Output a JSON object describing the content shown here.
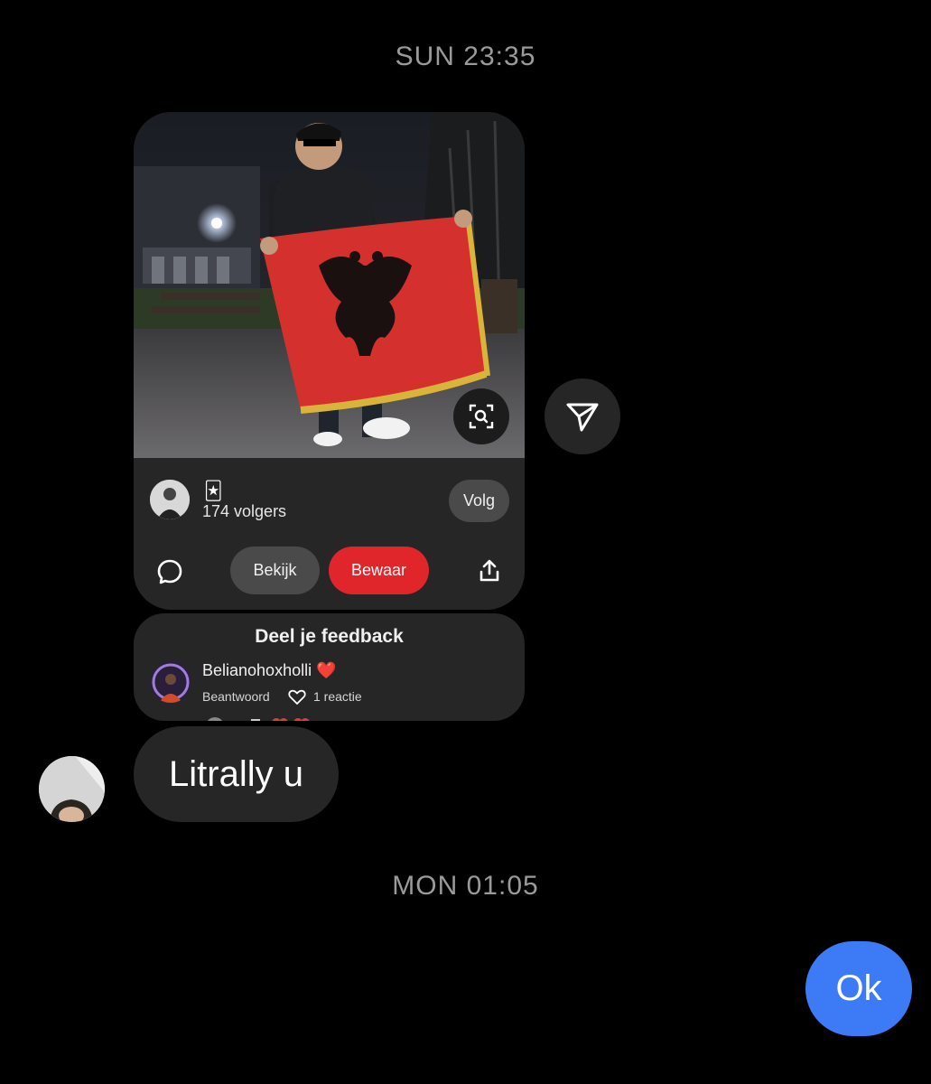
{
  "conversation": {
    "timestamp_1": "SUN 23:35",
    "timestamp_2": "MON 01:05"
  },
  "shared_pin": {
    "creator_emoji": "🃏",
    "followers": "174 volgers",
    "follow_label": "Volg",
    "view_label": "Bekijk",
    "save_label": "Bewaar",
    "save_color": "#e0262b"
  },
  "feedback": {
    "title": "Deel je feedback",
    "commenter": "Belianohoxholli ❤️",
    "reply_label": "Beantwoord",
    "reactions": "1 reactie"
  },
  "messages": {
    "incoming": "Litrally u",
    "outgoing": "Ok",
    "outgoing_color": "#3d7bf6"
  }
}
